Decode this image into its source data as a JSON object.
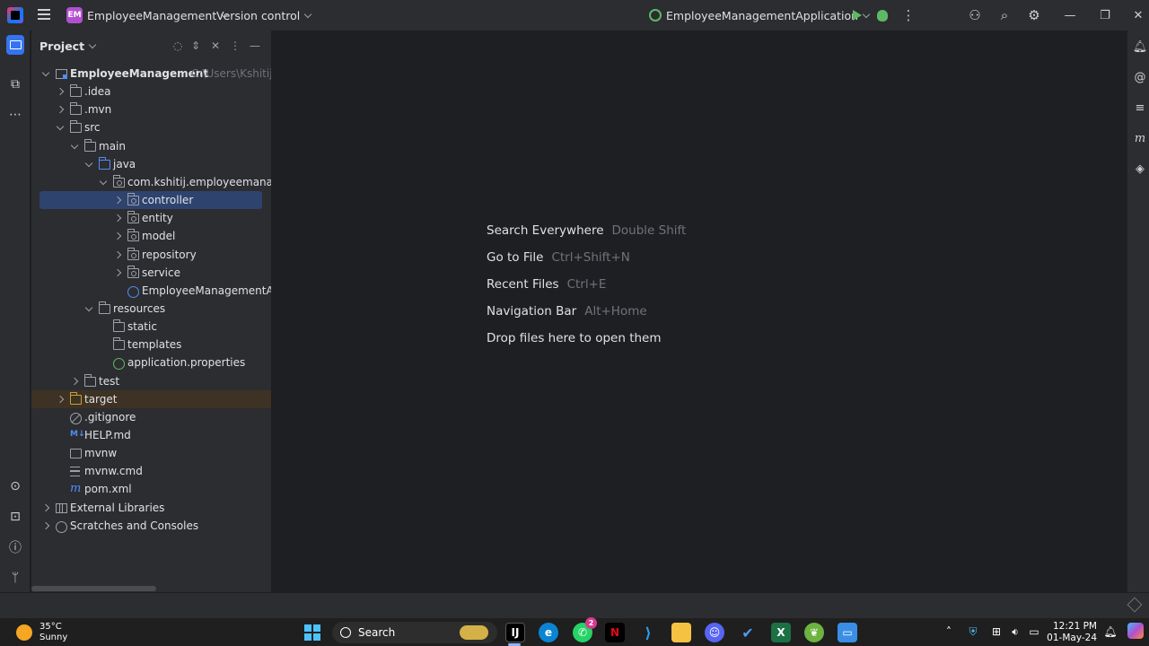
{
  "titlebar": {
    "project_badge": "EM",
    "project_name": "EmployeeManagement",
    "version_control": "Version control",
    "run_config": "EmployeeManagementApplication"
  },
  "panel": {
    "title": "Project"
  },
  "tree": [
    {
      "label": "EmployeeManagement",
      "hint": "C:\\Users\\Kshitij D",
      "depth": 0,
      "chevron": "down",
      "icon": "mod",
      "bold": true
    },
    {
      "label": ".idea",
      "depth": 1,
      "chevron": "right",
      "icon": "folder"
    },
    {
      "label": ".mvn",
      "depth": 1,
      "chevron": "right",
      "icon": "folder"
    },
    {
      "label": "src",
      "depth": 1,
      "chevron": "down",
      "icon": "folder"
    },
    {
      "label": "main",
      "depth": 2,
      "chevron": "down",
      "icon": "folder"
    },
    {
      "label": "java",
      "depth": 3,
      "chevron": "down",
      "icon": "folder-blue"
    },
    {
      "label": "com.kshitij.employeemanageme",
      "depth": 4,
      "chevron": "down",
      "icon": "pkg"
    },
    {
      "label": "controller",
      "depth": 5,
      "chevron": "right",
      "icon": "pkg",
      "selected": true
    },
    {
      "label": "entity",
      "depth": 5,
      "chevron": "right",
      "icon": "pkg"
    },
    {
      "label": "model",
      "depth": 5,
      "chevron": "right",
      "icon": "pkg"
    },
    {
      "label": "repository",
      "depth": 5,
      "chevron": "right",
      "icon": "pkg"
    },
    {
      "label": "service",
      "depth": 5,
      "chevron": "right",
      "icon": "pkg"
    },
    {
      "label": "EmployeeManagementAppli",
      "depth": 5,
      "chevron": "none",
      "icon": "classic"
    },
    {
      "label": "resources",
      "depth": 3,
      "chevron": "down",
      "icon": "folder"
    },
    {
      "label": "static",
      "depth": 4,
      "chevron": "none",
      "icon": "folder"
    },
    {
      "label": "templates",
      "depth": 4,
      "chevron": "none",
      "icon": "folder"
    },
    {
      "label": "application.properties",
      "depth": 4,
      "chevron": "none",
      "icon": "spring"
    },
    {
      "label": "test",
      "depth": 2,
      "chevron": "right",
      "icon": "folder"
    },
    {
      "label": "target",
      "depth": 1,
      "chevron": "right",
      "icon": "folder-orange",
      "excluded": true
    },
    {
      "label": ".gitignore",
      "depth": 1,
      "chevron": "none",
      "icon": "ignore"
    },
    {
      "label": "HELP.md",
      "depth": 1,
      "chevron": "none",
      "icon": "md"
    },
    {
      "label": "mvnw",
      "depth": 1,
      "chevron": "none",
      "icon": "term"
    },
    {
      "label": "mvnw.cmd",
      "depth": 1,
      "chevron": "none",
      "icon": "lines"
    },
    {
      "label": "pom.xml",
      "depth": 1,
      "chevron": "none",
      "icon": "maven"
    },
    {
      "label": "External Libraries",
      "depth": 0,
      "chevron": "right",
      "icon": "lib"
    },
    {
      "label": "Scratches and Consoles",
      "depth": 0,
      "chevron": "right",
      "icon": "scratch"
    }
  ],
  "editor_tips": [
    {
      "label": "Search Everywhere",
      "shortcut": "Double Shift"
    },
    {
      "label": "Go to File",
      "shortcut": "Ctrl+Shift+N"
    },
    {
      "label": "Recent Files",
      "shortcut": "Ctrl+E"
    },
    {
      "label": "Navigation Bar",
      "shortcut": "Alt+Home"
    },
    {
      "label": "Drop files here to open them",
      "shortcut": ""
    }
  ],
  "taskbar": {
    "temperature": "35°C",
    "weather": "Sunny",
    "search_label": "Search",
    "whatsapp_badge": "2",
    "time": "12:21 PM",
    "date": "01-May-24"
  },
  "colors": {
    "accent": "#3574f0",
    "selection": "#2e436e",
    "excluded": "#3d3223",
    "panel_bg": "#2b2d30",
    "editor_bg": "#1e1f22"
  }
}
